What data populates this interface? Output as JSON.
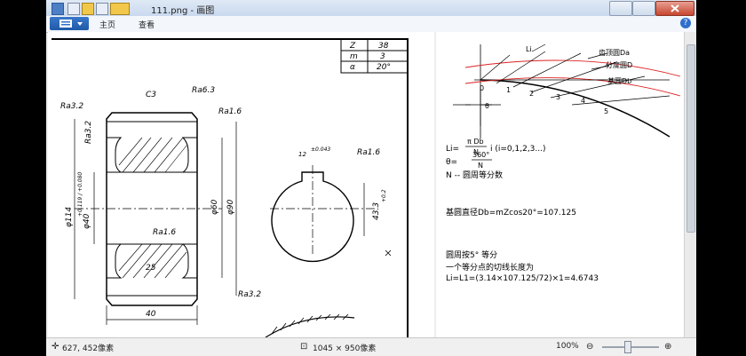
{
  "window": {
    "title": "111.png - 画图"
  },
  "ribbon": {
    "tabs": [
      "主页",
      "查看"
    ],
    "help_label": "?"
  },
  "status": {
    "cursor_pos": "627, 452像素",
    "image_size": "1045 × 950像素",
    "zoom": "100%"
  },
  "drawing": {
    "gear_table": [
      {
        "param": "Z",
        "value": "38"
      },
      {
        "param": "m",
        "value": "3"
      },
      {
        "param": "α",
        "value": "20°"
      }
    ],
    "chamfer": "C3",
    "roughness": [
      "Ra6.3",
      "Ra3.2",
      "Ra1.6",
      "Ra3.2",
      "Ra1.6",
      "Ra3.2",
      "Ra1.6"
    ],
    "dims": {
      "outer_dia": "φ114",
      "bore": "φ40",
      "bore_tol": "+0.119 / +0.080",
      "hub_60": "φ60",
      "hub_90": "φ90",
      "width": "40",
      "groove": "25",
      "key_dim": "43.3",
      "key_tol": "+0.2",
      "key_width": "12",
      "key_width_tol": "±0.043"
    }
  },
  "involute": {
    "labels": [
      "Li",
      "齿顶圆Da",
      "分度圆D",
      "基圆Db",
      "θ"
    ],
    "marks": [
      "0",
      "1",
      "2",
      "3",
      "4",
      "5"
    ]
  },
  "formulas": {
    "line1_a": "Li=",
    "line1_num": "π Db",
    "line1_den": "N",
    "line1_b": "i (i=0,1,2,3...)",
    "line2_a": "θ=",
    "line2_num": "360°",
    "line2_den": "N",
    "line3": "N -- 圆周等分数",
    "line4": "基圆直径Db=mZcos20°=107.125",
    "line5": "圆周按5° 等分",
    "line6": "一个等分点的切线长度为",
    "line7": "Li=L1=(3.14×107.125/72)×1=4.6743"
  }
}
